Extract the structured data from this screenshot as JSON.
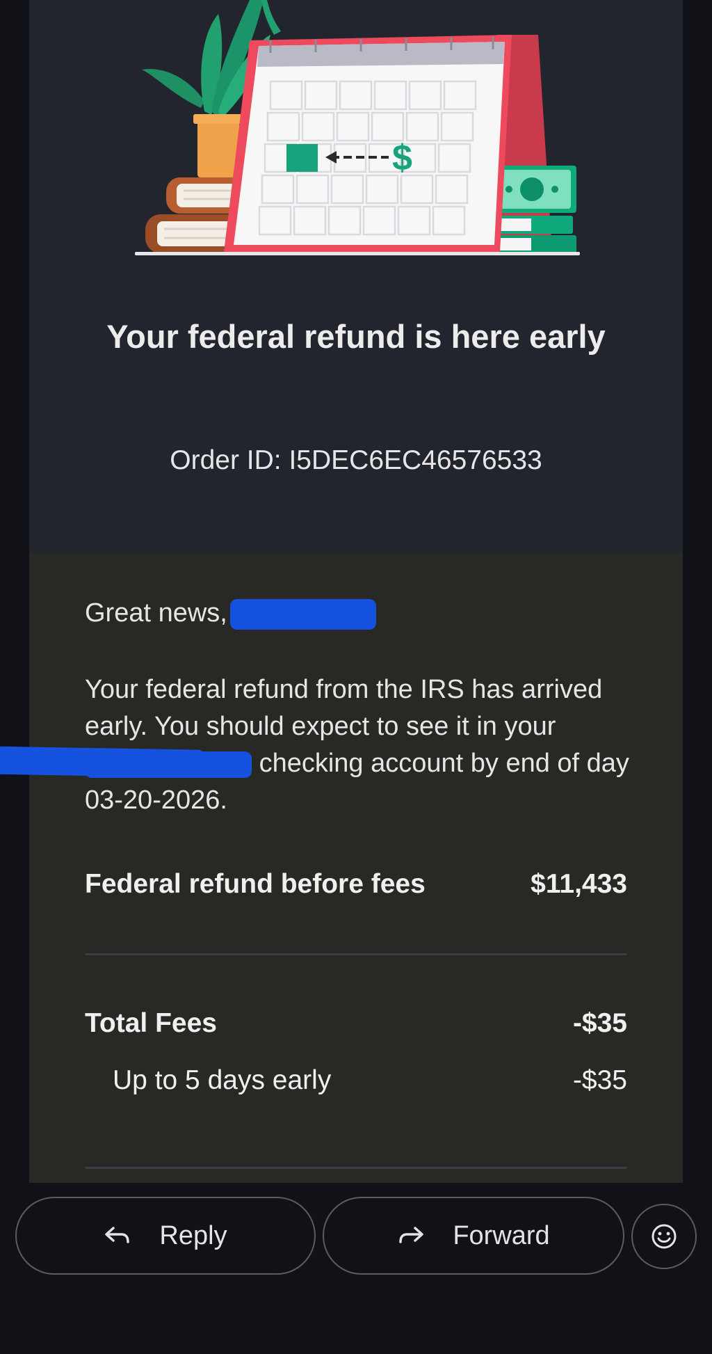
{
  "email": {
    "hero_title": "Your federal refund is here early",
    "order_label": "Order ID:",
    "order_id": "I5DEC6EC46576533",
    "greeting": "Great news,",
    "message_part1": "Your federal refund from the IRS has arrived early. You should expect to see it in your",
    "message_part2": "checking account by end of day 03-20-2026.",
    "refund_label": "Federal refund before fees",
    "refund_amount": "$11,433",
    "total_fees_label": "Total Fees",
    "total_fees_amount": "-$35",
    "fee_item_label": "Up to 5 days early",
    "fee_item_amount": "-$35"
  },
  "actions": {
    "reply_label": "Reply",
    "forward_label": "Forward"
  },
  "illustration": {
    "dollar_sign": "$"
  },
  "icons": {
    "reply": "reply-arrow-icon",
    "forward": "forward-arrow-icon",
    "emoji": "smiley-face-icon"
  },
  "colors": {
    "hero_bg": "#22252d",
    "body_bg": "#282925",
    "calendar_red": "#ee4a5e",
    "accent_green": "#17a37b",
    "redaction_blue": "#1652e0"
  }
}
